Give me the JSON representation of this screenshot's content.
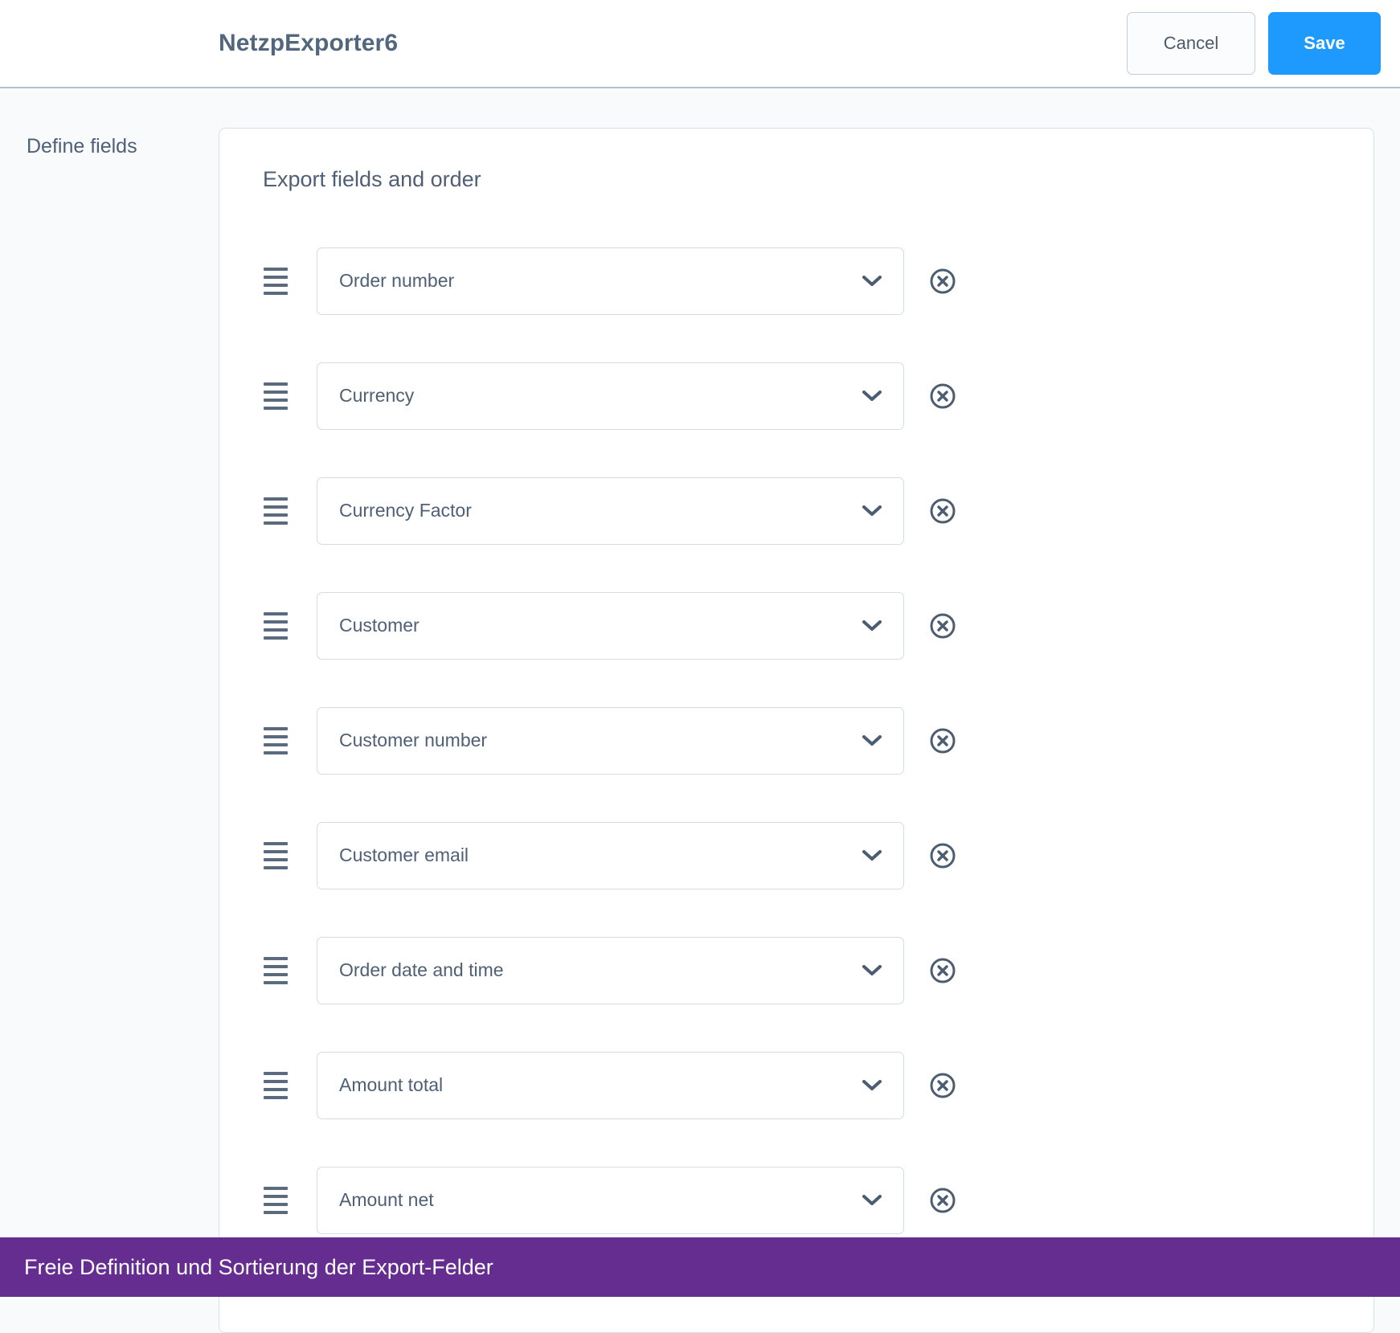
{
  "header": {
    "title": "NetzpExporter6",
    "cancel_label": "Cancel",
    "save_label": "Save",
    "save_color": "#1e9afe"
  },
  "sidebar": {
    "section_label": "Define fields"
  },
  "card": {
    "title": "Export fields and order",
    "fields": [
      {
        "label": "Order number"
      },
      {
        "label": "Currency"
      },
      {
        "label": "Currency Factor"
      },
      {
        "label": "Customer"
      },
      {
        "label": "Customer number"
      },
      {
        "label": "Customer email"
      },
      {
        "label": "Order date and time"
      },
      {
        "label": "Amount total"
      },
      {
        "label": "Amount net"
      }
    ],
    "row_icons": {
      "drag": "drag-handle-icon",
      "chevron": "chevron-down-icon",
      "remove": "remove-circle-icon"
    }
  },
  "footer": {
    "text": "Freie Definition und Sortierung der Export-Felder",
    "background_color": "#662d91"
  }
}
